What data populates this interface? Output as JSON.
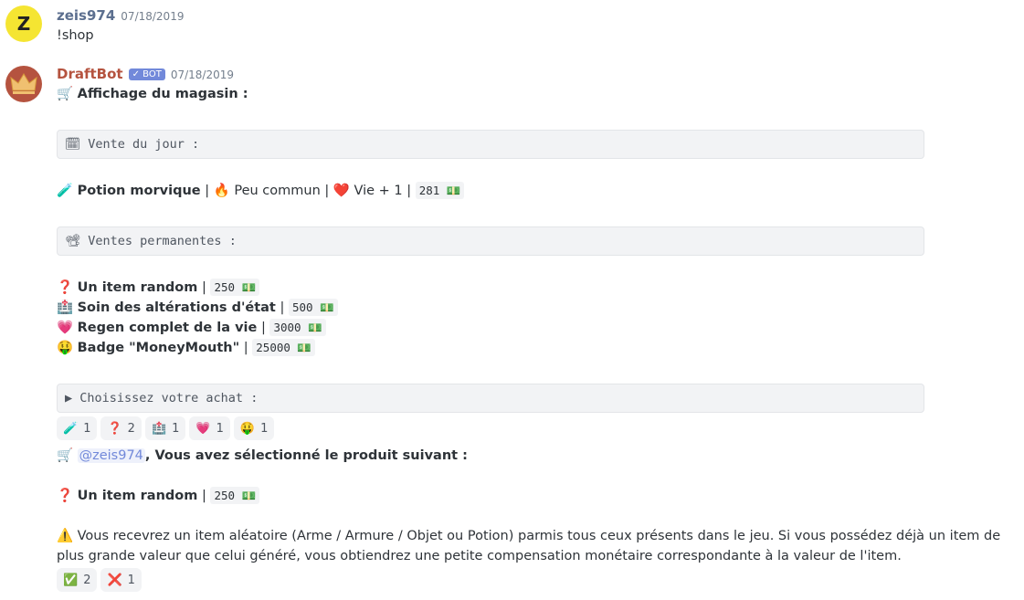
{
  "msg1": {
    "avatar_letter": "Z",
    "username": "zeis974",
    "timestamp": "07/18/2019",
    "content": "!shop"
  },
  "msg2": {
    "username": "DraftBot",
    "bot_tag": "✓ BOT",
    "timestamp": "07/18/2019",
    "title_icon": "🛒",
    "title": "Affichage du magasin :",
    "daily_header": "🗓 Vente du jour :",
    "daily_item": {
      "icon": "🧪",
      "name": "Potion morvique",
      "sep1": " | ",
      "rarity_icon": "🔥",
      "rarity": "Peu commun",
      "sep2": " | ",
      "effect_icon": "❤️",
      "effect": "Vie + 1",
      "sep3": " | ",
      "price": "281 💵"
    },
    "perm_header": "📽 Ventes permanentes :",
    "perm_items": [
      {
        "icon": "❓",
        "name": "Un item random",
        "sep": " | ",
        "price": "250 💵"
      },
      {
        "icon": "🏥",
        "name": "Soin des altérations d'état",
        "sep": " | ",
        "price": "500 💵"
      },
      {
        "icon": "💗",
        "name": "Regen complet de la vie",
        "sep": " | ",
        "price": "3000 💵"
      },
      {
        "icon": "🤑",
        "name": "Badge \"MoneyMouth\"",
        "sep": " | ",
        "price": "25000 💵"
      }
    ],
    "choose_header": "▶ Choisissez votre achat :",
    "reactions": [
      {
        "emoji": "🧪",
        "count": "1"
      },
      {
        "emoji": "❓",
        "count": "2"
      },
      {
        "emoji": "🏥",
        "count": "1"
      },
      {
        "emoji": "💗",
        "count": "1"
      },
      {
        "emoji": "🤑",
        "count": "1"
      }
    ]
  },
  "msg3": {
    "cart_icon": "🛒",
    "mention": "@zeis974",
    "text": ", Vous avez sélectionné le produit suivant :",
    "item_icon": "❓",
    "item_name": "Un item random",
    "item_sep": " | ",
    "item_price": "250 💵",
    "warn_icon": "⚠️",
    "warning": "Vous recevrez un item aléatoire (Arme / Armure / Objet ou Potion) parmis tous ceux présents dans le jeu. Si vous possédez déjà un item de plus grande valeur que celui généré, vous obtiendrez une petite compensation monétaire correspondante à la valeur de l'item.",
    "reactions": [
      {
        "emoji": "✅",
        "count": "2"
      },
      {
        "emoji": "❌",
        "count": "1"
      }
    ]
  }
}
